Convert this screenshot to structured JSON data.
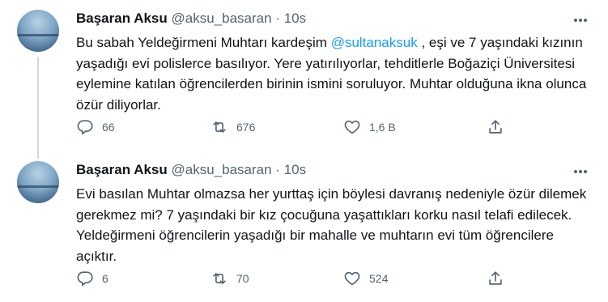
{
  "tweets": [
    {
      "author_name": "Başaran Aksu",
      "handle": "@aksu_basaran",
      "separator": "·",
      "time": "10s",
      "text_before_mention": "Bu sabah Yeldeğirmeni Muhtarı kardeşim ",
      "mention": "@sultanaksuk",
      "text_after_mention": " ,  eşi ve 7 yaşındaki kızının yaşadığı evi polislerce basılıyor. Yere yatırılıyorlar,  tehditlerle Boğaziçi Üniversitesi eylemine katılan öğrencilerden birinin ismini soruluyor. Muhtar olduğuna ikna olunca özür diliyorlar.",
      "replies": "66",
      "retweets": "676",
      "likes": "1,6 B"
    },
    {
      "author_name": "Başaran Aksu",
      "handle": "@aksu_basaran",
      "separator": "·",
      "time": "10s",
      "text": "Evi basılan Muhtar olmazsa her yurttaş için böylesi davranış nedeniyle özür dilemek gerekmez mi? 7 yaşındaki bir kız çocuğuna yaşattıkları korku nasıl telafi edilecek. Yeldeğirmeni öğrencilerin yaşadığı bir mahalle ve muhtarın evi tüm öğrencilere açıktır.",
      "replies": "6",
      "retweets": "70",
      "likes": "524"
    }
  ],
  "icons": {
    "reply": "reply-icon",
    "retweet": "retweet-icon",
    "like": "heart-icon",
    "share": "share-icon",
    "more": "more-icon"
  },
  "colors": {
    "text": "#0f1419",
    "muted": "#536471",
    "link": "#1d9bf0",
    "thread_line": "#cfd9de"
  }
}
